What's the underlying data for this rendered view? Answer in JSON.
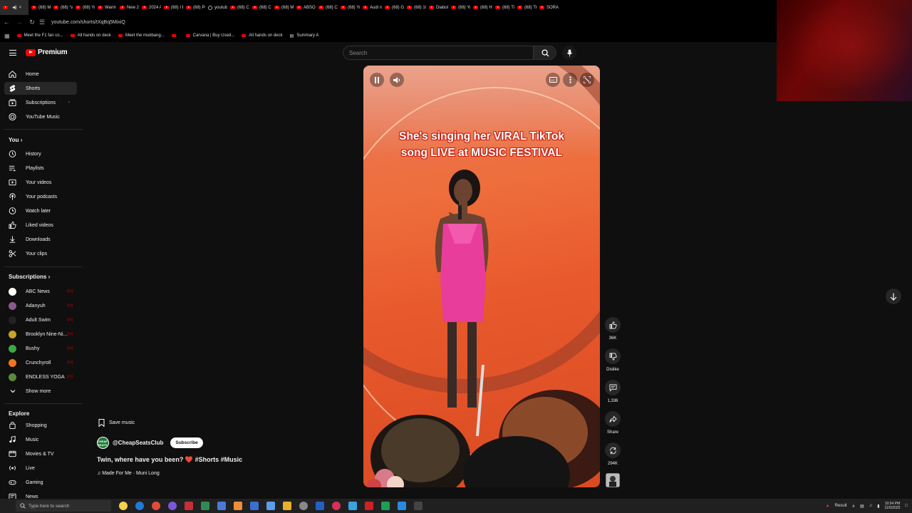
{
  "browser": {
    "tabs": [
      {
        "label": "",
        "icon": "youtube",
        "active": true
      },
      {
        "label": "(68) M",
        "icon": "youtube"
      },
      {
        "label": "(68) *a",
        "icon": "youtube"
      },
      {
        "label": "(68) Yo",
        "icon": "youtube"
      },
      {
        "label": "Warm",
        "icon": "youtube"
      },
      {
        "label": "New 2l",
        "icon": "youtube"
      },
      {
        "label": "2024 A",
        "icon": "youtube"
      },
      {
        "label": "(68) I B",
        "icon": "youtube"
      },
      {
        "label": "(68) PC",
        "icon": "youtube"
      },
      {
        "label": "youtub",
        "icon": "globe"
      },
      {
        "label": "(68) Cr",
        "icon": "youtube"
      },
      {
        "label": "(68) Cr",
        "icon": "youtube"
      },
      {
        "label": "(68) M",
        "icon": "youtube"
      },
      {
        "label": "ABSOL",
        "icon": "youtube"
      },
      {
        "label": "(68) Cc",
        "icon": "youtube"
      },
      {
        "label": "(68) Yo",
        "icon": "youtube"
      },
      {
        "label": "Audi n",
        "icon": "youtube"
      },
      {
        "label": "(68) Gl",
        "icon": "youtube"
      },
      {
        "label": "(68) 10",
        "icon": "youtube"
      },
      {
        "label": "Diaboli",
        "icon": "youtube"
      },
      {
        "label": "(68) Yo",
        "icon": "youtube"
      },
      {
        "label": "(68) He",
        "icon": "youtube"
      },
      {
        "label": "(68) Ti",
        "icon": "youtube"
      },
      {
        "label": "(68) Th",
        "icon": "youtube"
      },
      {
        "label": "SORA",
        "icon": "youtube"
      }
    ],
    "url": "youtube.com/shorts/tXqBq5MixiQ",
    "bookmarks": [
      {
        "label": "Meet the F1 fan co...",
        "icon": "youtube"
      },
      {
        "label": "All hands on deck",
        "icon": "youtube"
      },
      {
        "label": "Meet the mukbang...",
        "icon": "youtube"
      },
      {
        "label": "",
        "icon": "youtube"
      },
      {
        "label": "Carvana | Buy Used...",
        "icon": "youtube"
      },
      {
        "label": "All hands on deck",
        "icon": "youtube"
      },
      {
        "label": "Summary A",
        "icon": "bookmark"
      }
    ]
  },
  "header": {
    "logo_text": "Premium",
    "search_placeholder": "Search"
  },
  "sidebar": {
    "main": [
      {
        "label": "Home",
        "icon": "home-icon"
      },
      {
        "label": "Shorts",
        "icon": "shorts-icon",
        "active": true
      },
      {
        "label": "Subscriptions",
        "icon": "subscriptions-icon"
      },
      {
        "label": "YouTube Music",
        "icon": "music-circle-icon"
      }
    ],
    "you_heading": "You",
    "you": [
      {
        "label": "History",
        "icon": "history-icon"
      },
      {
        "label": "Playlists",
        "icon": "playlists-icon"
      },
      {
        "label": "Your videos",
        "icon": "your-videos-icon"
      },
      {
        "label": "Your podcasts",
        "icon": "podcasts-icon"
      },
      {
        "label": "Watch later",
        "icon": "clock-icon"
      },
      {
        "label": "Liked videos",
        "icon": "like-icon"
      },
      {
        "label": "Downloads",
        "icon": "download-icon"
      },
      {
        "label": "Your clips",
        "icon": "scissors-icon"
      }
    ],
    "subscriptions_heading": "Subscriptions",
    "subscriptions": [
      {
        "label": "ABC News",
        "avatar_color": "#ffffff"
      },
      {
        "label": "Adanyuh",
        "avatar_color": "#8a5a8a"
      },
      {
        "label": "Adult Swim",
        "avatar_color": "#222222"
      },
      {
        "label": "Brooklyn Nine-Ni...",
        "avatar_color": "#c9a227"
      },
      {
        "label": "Bushy",
        "avatar_color": "#3aa845"
      },
      {
        "label": "Crunchyroll",
        "avatar_color": "#f47521"
      },
      {
        "label": "ENDLESS YOGA",
        "avatar_color": "#5a8a3a"
      }
    ],
    "show_more": "Show more",
    "explore_heading": "Explore",
    "explore": [
      {
        "label": "Shopping",
        "icon": "shopping-bag-icon"
      },
      {
        "label": "Music",
        "icon": "music-note-icon"
      },
      {
        "label": "Movies & TV",
        "icon": "movies-icon"
      },
      {
        "label": "Live",
        "icon": "live-icon"
      },
      {
        "label": "Gaming",
        "icon": "gaming-icon"
      },
      {
        "label": "News",
        "icon": "news-icon"
      }
    ]
  },
  "video": {
    "overlay_line1": "She's singing her VIRAL TikTok",
    "overlay_line2": "song LIVE at MUSIC FESTIVAL"
  },
  "actions": {
    "likes": "36K",
    "dislike": "Dislike",
    "comments": "1,336",
    "share": "Share",
    "remix": "294K"
  },
  "info": {
    "save_music": "Save music",
    "channel": "@CheapSeatsClub",
    "channel_avatar_text": "CHEAP SEATS",
    "subscribe": "Subscribe",
    "title": "Twin, where have you been? ❤️ #Shorts #Music",
    "song": "♫ Made For Me · Muni Long"
  },
  "taskbar": {
    "search_placeholder": "Type here to search",
    "tray_label": "Result",
    "time": "10:54 PM",
    "date": "11/5/2025"
  },
  "colors": {
    "accent": "#ff0000",
    "background": "#0f0f0f",
    "video_bg": "#e8592c"
  }
}
